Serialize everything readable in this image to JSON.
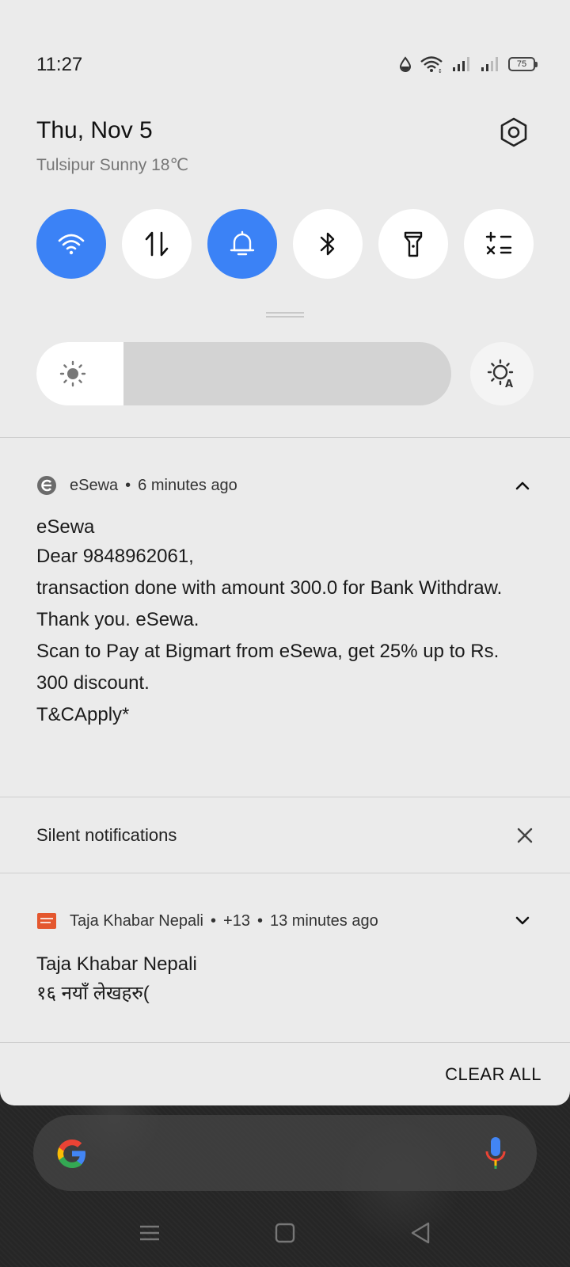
{
  "status_bar": {
    "time": "11:27",
    "battery": "75"
  },
  "header": {
    "date": "Thu, Nov 5",
    "weather": "Tulsipur Sunny 18℃"
  },
  "quick_tiles": [
    {
      "name": "wifi",
      "icon": "wifi-icon",
      "active": true
    },
    {
      "name": "mobile-data",
      "icon": "data-arrows-icon",
      "active": false
    },
    {
      "name": "sound",
      "icon": "bell-icon",
      "active": true
    },
    {
      "name": "bluetooth",
      "icon": "bluetooth-icon",
      "active": false
    },
    {
      "name": "flashlight",
      "icon": "flashlight-icon",
      "active": false
    },
    {
      "name": "calculator",
      "icon": "calculator-icon",
      "active": false
    }
  ],
  "brightness": {
    "level": 0.21
  },
  "notifications": {
    "esewa": {
      "app": "eSewa",
      "time": "6 minutes ago",
      "title": "eSewa",
      "lines": [
        "Dear 9848962061,",
        "transaction done with amount 300.0 for Bank Withdraw.",
        "Thank you. eSewa.",
        "Scan to Pay at Bigmart from eSewa, get 25% up to Rs. 300 discount.",
        "T&CApply*"
      ]
    },
    "silent": {
      "label": "Silent notifications"
    },
    "taja": {
      "app": "Taja Khabar Nepali",
      "count": "+13",
      "time": "13 minutes ago",
      "title": "Taja Khabar Nepali",
      "text": "१६ नयाँ लेखहरु("
    }
  },
  "clear_all": "CLEAR ALL",
  "colors": {
    "accent": "#3b82f6",
    "shade_bg": "#ebebeb"
  }
}
